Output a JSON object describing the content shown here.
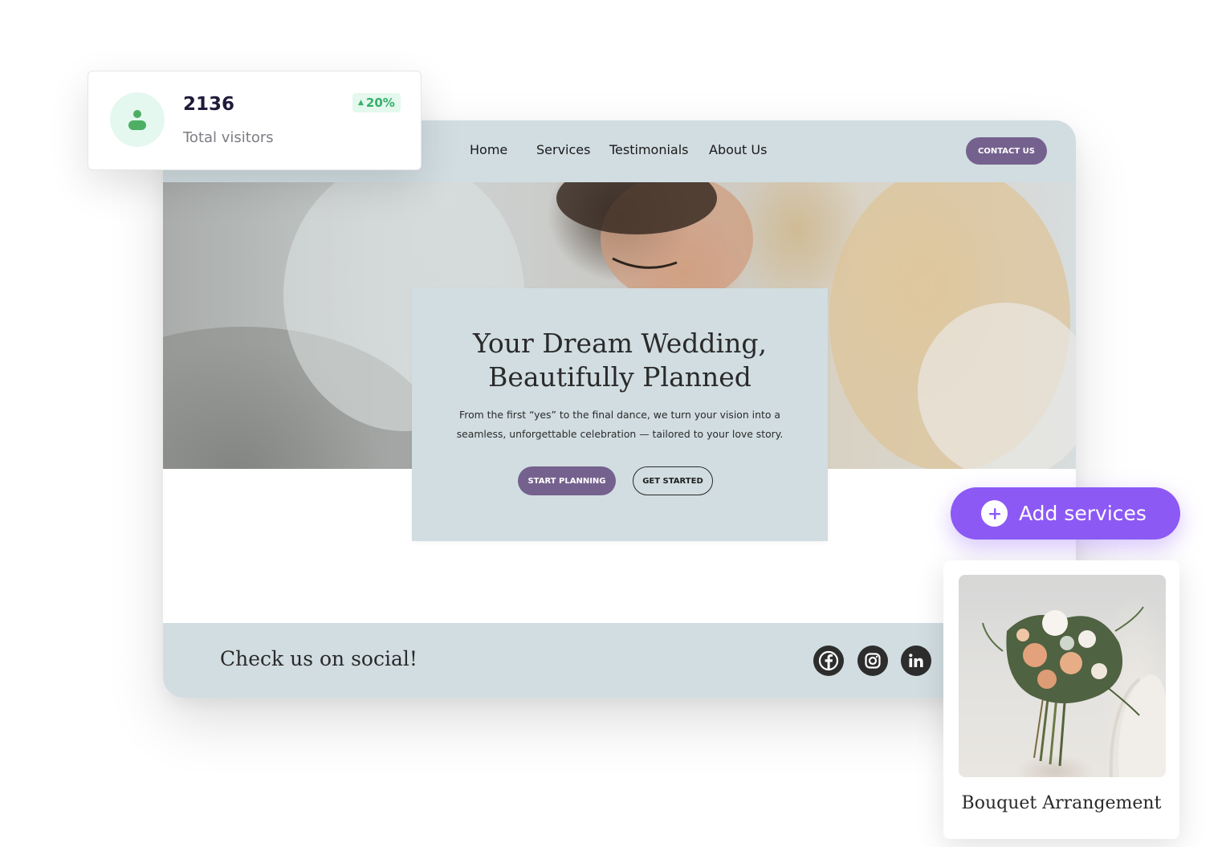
{
  "site": {
    "nav": {
      "links": [
        "Home",
        "Services",
        "Testimonials",
        "About Us"
      ],
      "contact_label": "CONTACT US"
    },
    "hero": {
      "title_line1": "Your Dream Wedding,",
      "title_line2": "Beautifully Planned",
      "text_line1": "From the first “yes” to the final dance, we turn your vision into a",
      "text_line2": "seamless, unforgettable celebration — tailored to your love story.",
      "primary_button": "START PLANNING",
      "secondary_button": "GET STARTED"
    },
    "social": {
      "title": "Check us on social!",
      "icons": [
        "facebook-icon",
        "instagram-icon",
        "linkedin-icon"
      ]
    }
  },
  "stats": {
    "value": "2136",
    "label": "Total visitors",
    "change": "20%"
  },
  "add_services": {
    "label": "Add services"
  },
  "service_card": {
    "title": "Bouquet Arrangement"
  },
  "colors": {
    "accent_purple": "#75618e",
    "add_button_purple": "#8c59f5",
    "panel_blue_gray": "#d1dde1",
    "stat_green": "#35b06a"
  }
}
